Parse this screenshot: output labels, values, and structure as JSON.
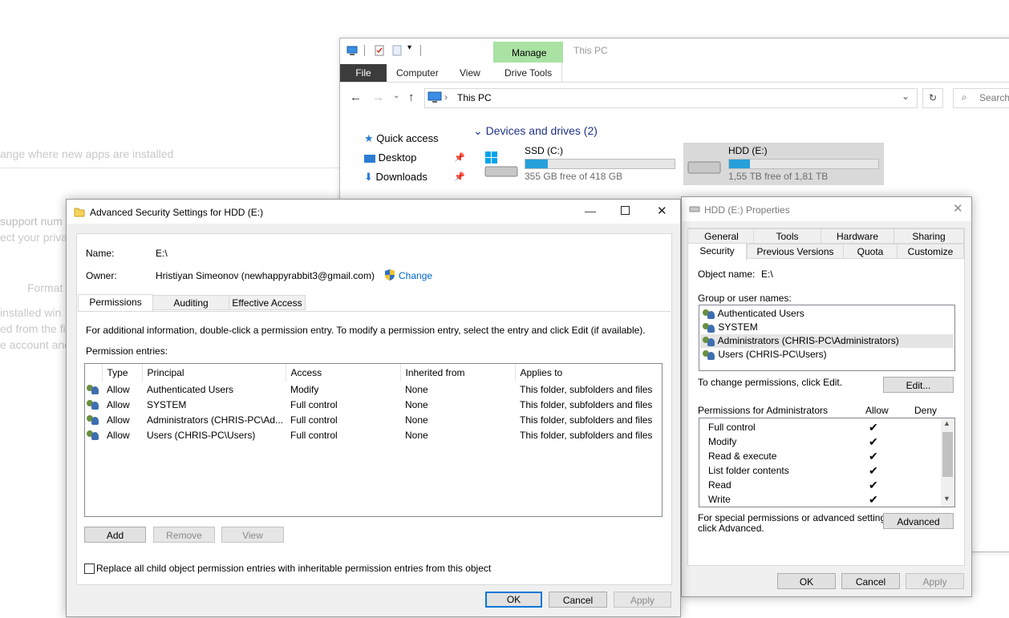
{
  "background": {
    "line1": "ange where new apps are installed",
    "line2": "support num",
    "line3": "ect your privac",
    "line4": "Format",
    "line5": "installed win",
    "line6": "ed from the fi",
    "line7": "e account and"
  },
  "explorer": {
    "manage_label": "Manage",
    "window_title": "This PC",
    "tabs": [
      "File",
      "Computer",
      "View",
      "Drive Tools"
    ],
    "address": "This PC",
    "search_placeholder": "Search",
    "nav": [
      {
        "label": "Quick access"
      },
      {
        "label": "Desktop"
      },
      {
        "label": "Downloads"
      }
    ],
    "section_title": "Devices and drives (2)",
    "drives": [
      {
        "name": "SSD (C:)",
        "free": "355 GB free of 418 GB",
        "used_fraction": 0.15
      },
      {
        "name": "HDD (E:)",
        "free": "1,55 TB free of 1,81 TB",
        "used_fraction": 0.14
      }
    ]
  },
  "adv": {
    "title": "Advanced Security Settings for HDD (E:)",
    "name_label": "Name:",
    "name_value": "E:\\",
    "owner_label": "Owner:",
    "owner_value": "Hristiyan Simeonov (newhappyrabbit3@gmail.com)",
    "change_label": "Change",
    "tabs": [
      "Permissions",
      "Auditing",
      "Effective Access"
    ],
    "info": "For additional information, double-click a permission entry. To modify a permission entry, select the entry and click Edit (if available).",
    "entries_label": "Permission entries:",
    "columns": [
      "Type",
      "Principal",
      "Access",
      "Inherited from",
      "Applies to"
    ],
    "rows": [
      {
        "type": "Allow",
        "principal": "Authenticated Users",
        "access": "Modify",
        "inherited": "None",
        "applies": "This folder, subfolders and files"
      },
      {
        "type": "Allow",
        "principal": "SYSTEM",
        "access": "Full control",
        "inherited": "None",
        "applies": "This folder, subfolders and files"
      },
      {
        "type": "Allow",
        "principal": "Administrators (CHRIS-PC\\Ad...",
        "access": "Full control",
        "inherited": "None",
        "applies": "This folder, subfolders and files"
      },
      {
        "type": "Allow",
        "principal": "Users (CHRIS-PC\\Users)",
        "access": "Full control",
        "inherited": "None",
        "applies": "This folder, subfolders and files"
      }
    ],
    "add": "Add",
    "remove": "Remove",
    "view": "View",
    "replace_checkbox": "Replace all child object permission entries with inheritable permission entries from this object",
    "ok": "OK",
    "cancel": "Cancel",
    "apply": "Apply"
  },
  "props": {
    "title": "HDD (E:) Properties",
    "tabs_row1": [
      "General",
      "Tools",
      "Hardware",
      "Sharing"
    ],
    "tabs_row2": [
      "Security",
      "Previous Versions",
      "Quota",
      "Customize"
    ],
    "object_label": "Object name:",
    "object_value": "E:\\",
    "group_label": "Group or user names:",
    "groups": [
      "Authenticated Users",
      "SYSTEM",
      "Administrators (CHRIS-PC\\Administrators)",
      "Users (CHRIS-PC\\Users)"
    ],
    "change_hint": "To change permissions, click Edit.",
    "edit": "Edit...",
    "perm_for": "Permissions for Administrators",
    "allow": "Allow",
    "deny": "Deny",
    "perms": [
      "Full control",
      "Modify",
      "Read & execute",
      "List folder contents",
      "Read",
      "Write"
    ],
    "special_line1": "For special permissions or advanced settings,",
    "special_line2": "click Advanced.",
    "advanced": "Advanced",
    "ok": "OK",
    "cancel": "Cancel",
    "apply": "Apply"
  }
}
